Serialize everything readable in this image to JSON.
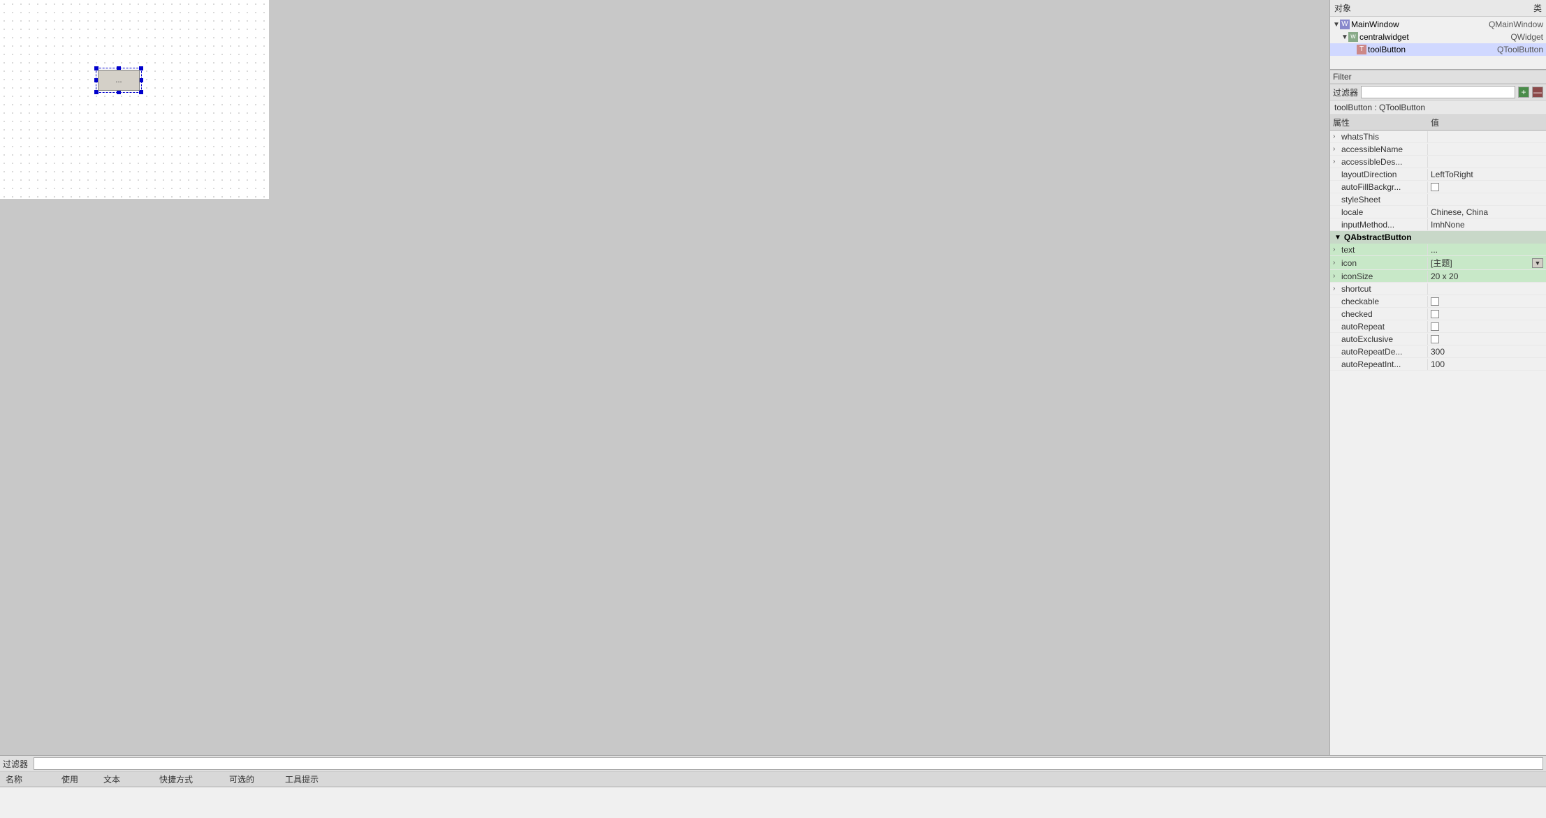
{
  "canvas": {
    "widget_label": "..."
  },
  "object_panel": {
    "col_object": "对象",
    "col_class": "类",
    "items": [
      {
        "id": "main-window",
        "name": "MainWindow",
        "class": "QMainWindow",
        "indent": 1,
        "expanded": true,
        "icon": "W"
      },
      {
        "id": "central-widget",
        "name": "centralwidget",
        "class": "QWidget",
        "indent": 2,
        "expanded": true,
        "icon": "w"
      },
      {
        "id": "tool-button",
        "name": "toolButton",
        "class": "QToolButton",
        "indent": 3,
        "expanded": false,
        "icon": "T",
        "selected": true
      }
    ]
  },
  "filter_panel": {
    "label": "过滤器",
    "add_btn": "+",
    "remove_btn": "—"
  },
  "props_panel": {
    "title": "toolButton : QToolButton",
    "col_property": "属性",
    "col_value": "值",
    "section_abstract_button": "QAbstractButton",
    "rows": [
      {
        "id": "whats-this",
        "name": "whatsThis",
        "value": "",
        "type": "text",
        "expandable": true
      },
      {
        "id": "accessible-name",
        "name": "accessibleName",
        "value": "",
        "type": "text",
        "expandable": true
      },
      {
        "id": "accessible-des",
        "name": "accessibleDes...",
        "value": "",
        "type": "text",
        "expandable": true
      },
      {
        "id": "layout-direction",
        "name": "layoutDirection",
        "value": "LeftToRight",
        "type": "text",
        "expandable": false
      },
      {
        "id": "auto-fill-bgr",
        "name": "autoFillBackgr...",
        "value": "",
        "type": "checkbox",
        "expandable": false,
        "checked": false
      },
      {
        "id": "style-sheet",
        "name": "styleSheet",
        "value": "",
        "type": "text",
        "expandable": false
      },
      {
        "id": "locale",
        "name": "locale",
        "value": "Chinese, China",
        "type": "text",
        "expandable": false
      },
      {
        "id": "input-method",
        "name": "inputMethod...",
        "value": "ImhNone",
        "type": "text",
        "expandable": false
      },
      {
        "id": "text",
        "name": "text",
        "value": "...",
        "type": "text",
        "expandable": true,
        "highlighted": true
      },
      {
        "id": "icon",
        "name": "icon",
        "value": "[主题]",
        "type": "text",
        "expandable": true,
        "has_edit": true
      },
      {
        "id": "icon-size",
        "name": "iconSize",
        "value": "20 x 20",
        "type": "text",
        "expandable": true
      },
      {
        "id": "shortcut",
        "name": "shortcut",
        "value": "",
        "type": "text",
        "expandable": true
      },
      {
        "id": "checkable",
        "name": "checkable",
        "value": "",
        "type": "checkbox",
        "expandable": false,
        "checked": false
      },
      {
        "id": "checked",
        "name": "checked",
        "value": "",
        "type": "checkbox",
        "expandable": false,
        "checked": false
      },
      {
        "id": "auto-repeat",
        "name": "autoRepeat",
        "value": "",
        "type": "checkbox",
        "expandable": false,
        "checked": false
      },
      {
        "id": "auto-exclusive",
        "name": "autoExclusive",
        "value": "",
        "type": "checkbox",
        "expandable": false,
        "checked": false
      },
      {
        "id": "auto-repeat-de",
        "name": "autoRepeatDe...",
        "value": "300",
        "type": "text",
        "expandable": false
      },
      {
        "id": "auto-repeat-int",
        "name": "autoRepeatInt...",
        "value": "100",
        "type": "text",
        "expandable": false
      }
    ]
  },
  "bottom_panel": {
    "filter_label": "过滤器",
    "cols": [
      "名称",
      "使用",
      "文本",
      "快捷方式",
      "可选的",
      "工具提示"
    ]
  }
}
